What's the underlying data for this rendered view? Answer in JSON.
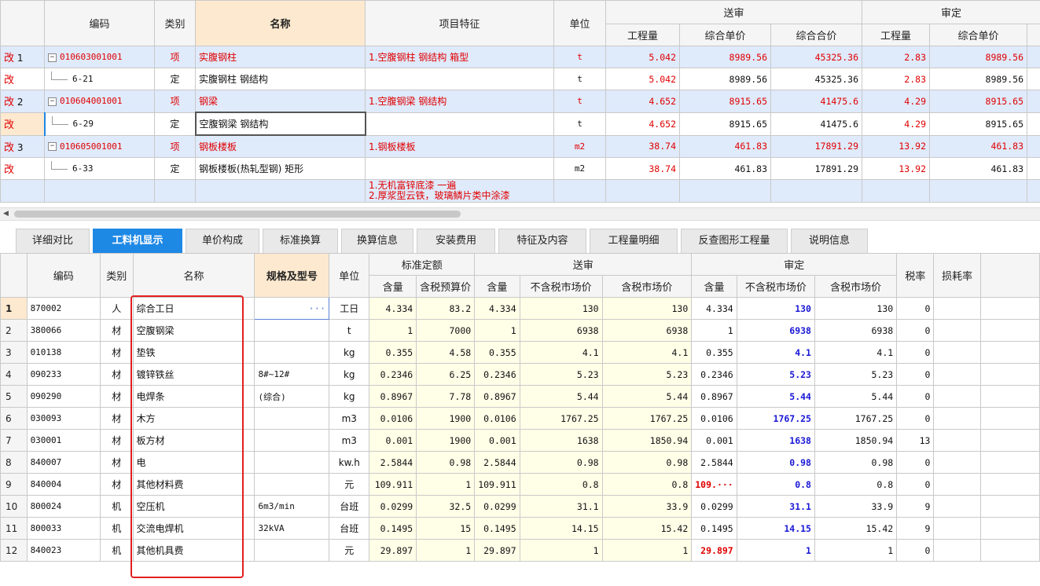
{
  "top_table": {
    "headers": {
      "code": "编码",
      "type": "类别",
      "name": "名称",
      "feature": "项目特征",
      "unit": "单位",
      "submit_group": "送审",
      "approve_group": "审定",
      "qty": "工程量",
      "unit_price": "综合单价",
      "total": "综合合价",
      "a_qty": "工程量",
      "a_unit_price": "综合单价"
    },
    "rows": [
      {
        "mark": "改",
        "idx": "1",
        "code": "010603001001",
        "type": "项",
        "name": "实腹钢柱",
        "feature": "1.空腹钢柱 钢结构 箱型",
        "unit": "t",
        "qty": "5.042",
        "price": "8989.56",
        "total": "45325.36",
        "a_qty": "2.83",
        "a_price": "8989.56"
      },
      {
        "mark": "改",
        "idx": "",
        "code": "6-21",
        "type": "定",
        "name": "实腹钢柱 钢结构",
        "feature": "",
        "unit": "t",
        "qty": "5.042",
        "price": "8989.56",
        "total": "45325.36",
        "a_qty": "2.83",
        "a_price": "8989.56"
      },
      {
        "mark": "改",
        "idx": "2",
        "code": "010604001001",
        "type": "项",
        "name": "钢梁",
        "feature": "1.空腹钢梁 钢结构",
        "unit": "t",
        "qty": "4.652",
        "price": "8915.65",
        "total": "41475.6",
        "a_qty": "4.29",
        "a_price": "8915.65"
      },
      {
        "mark": "改",
        "idx": "",
        "code": "6-29",
        "type": "定",
        "name": "空腹钢梁 钢结构",
        "feature": "",
        "unit": "t",
        "qty": "4.652",
        "price": "8915.65",
        "total": "41475.6",
        "a_qty": "4.29",
        "a_price": "8915.65"
      },
      {
        "mark": "改",
        "idx": "3",
        "code": "010605001001",
        "type": "项",
        "name": "钢板楼板",
        "feature": "1.钢板楼板",
        "unit": "m2",
        "qty": "38.74",
        "price": "461.83",
        "total": "17891.29",
        "a_qty": "13.92",
        "a_price": "461.83"
      },
      {
        "mark": "改",
        "idx": "",
        "code": "6-33",
        "type": "定",
        "name": "钢板楼板(热轧型钢) 矩形",
        "feature": "",
        "unit": "m2",
        "qty": "38.74",
        "price": "461.83",
        "total": "17891.29",
        "a_qty": "13.92",
        "a_price": "461.83"
      }
    ],
    "partial_feature_line1": "1.无机富锌底漆 一遍",
    "partial_feature_line2": "2.厚浆型云铁，玻璃鳞片类中涂漆"
  },
  "tabs": [
    "详细对比",
    "工料机显示",
    "单价构成",
    "标准换算",
    "换算信息",
    "安装费用",
    "特征及内容",
    "工程量明细",
    "反查图形工程量",
    "说明信息"
  ],
  "active_tab": "工料机显示",
  "bottom_table": {
    "headers": {
      "code": "编码",
      "type": "类别",
      "name": "名称",
      "spec": "规格及型号",
      "unit": "单位",
      "std_group": "标准定额",
      "submit_group": "送审",
      "approve_group": "审定",
      "tax": "税率",
      "loss": "损耗率",
      "std_qty": "含量",
      "std_price": "含税预算价",
      "s_qty": "含量",
      "s_excl": "不含税市场价",
      "s_incl": "含税市场价",
      "a_qty": "含量",
      "a_excl": "不含税市场价",
      "a_incl": "含税市场价"
    },
    "rows": [
      {
        "idx": "1",
        "code": "870002",
        "type": "人",
        "name": "综合工日",
        "spec": "",
        "unit": "工日",
        "std_qty": "4.334",
        "std_price": "83.2",
        "s_qty": "4.334",
        "s_excl": "130",
        "s_incl": "130",
        "a_qty": "4.334",
        "a_excl": "130",
        "a_incl": "130",
        "tax": "0"
      },
      {
        "idx": "2",
        "code": "380066",
        "type": "材",
        "name": "空腹钢梁",
        "spec": "",
        "unit": "t",
        "std_qty": "1",
        "std_price": "7000",
        "s_qty": "1",
        "s_excl": "6938",
        "s_incl": "6938",
        "a_qty": "1",
        "a_excl": "6938",
        "a_incl": "6938",
        "tax": "0"
      },
      {
        "idx": "3",
        "code": "010138",
        "type": "材",
        "name": "垫铁",
        "spec": "",
        "unit": "kg",
        "std_qty": "0.355",
        "std_price": "4.58",
        "s_qty": "0.355",
        "s_excl": "4.1",
        "s_incl": "4.1",
        "a_qty": "0.355",
        "a_excl": "4.1",
        "a_incl": "4.1",
        "tax": "0"
      },
      {
        "idx": "4",
        "code": "090233",
        "type": "材",
        "name": "镀锌铁丝",
        "spec": "8#~12#",
        "unit": "kg",
        "std_qty": "0.2346",
        "std_price": "6.25",
        "s_qty": "0.2346",
        "s_excl": "5.23",
        "s_incl": "5.23",
        "a_qty": "0.2346",
        "a_excl": "5.23",
        "a_incl": "5.23",
        "tax": "0"
      },
      {
        "idx": "5",
        "code": "090290",
        "type": "材",
        "name": "电焊条",
        "spec": "(综合)",
        "unit": "kg",
        "std_qty": "0.8967",
        "std_price": "7.78",
        "s_qty": "0.8967",
        "s_excl": "5.44",
        "s_incl": "5.44",
        "a_qty": "0.8967",
        "a_excl": "5.44",
        "a_incl": "5.44",
        "tax": "0"
      },
      {
        "idx": "6",
        "code": "030093",
        "type": "材",
        "name": "木方",
        "spec": "",
        "unit": "m3",
        "std_qty": "0.0106",
        "std_price": "1900",
        "s_qty": "0.0106",
        "s_excl": "1767.25",
        "s_incl": "1767.25",
        "a_qty": "0.0106",
        "a_excl": "1767.25",
        "a_incl": "1767.25",
        "tax": "0"
      },
      {
        "idx": "7",
        "code": "030001",
        "type": "材",
        "name": "板方材",
        "spec": "",
        "unit": "m3",
        "std_qty": "0.001",
        "std_price": "1900",
        "s_qty": "0.001",
        "s_excl": "1638",
        "s_incl": "1850.94",
        "a_qty": "0.001",
        "a_excl": "1638",
        "a_incl": "1850.94",
        "tax": "13"
      },
      {
        "idx": "8",
        "code": "840007",
        "type": "材",
        "name": "电",
        "spec": "",
        "unit": "kw.h",
        "std_qty": "2.5844",
        "std_price": "0.98",
        "s_qty": "2.5844",
        "s_excl": "0.98",
        "s_incl": "0.98",
        "a_qty": "2.5844",
        "a_excl": "0.98",
        "a_incl": "0.98",
        "tax": "0"
      },
      {
        "idx": "9",
        "code": "840004",
        "type": "材",
        "name": "其他材料费",
        "spec": "",
        "unit": "元",
        "std_qty": "109.911",
        "std_price": "1",
        "s_qty": "109.911",
        "s_excl": "0.8",
        "s_incl": "0.8",
        "a_qty": "109.···",
        "a_excl": "0.8",
        "a_incl": "0.8",
        "tax": "0"
      },
      {
        "idx": "10",
        "code": "800024",
        "type": "机",
        "name": "空压机",
        "spec": "6m3/min",
        "unit": "台班",
        "std_qty": "0.0299",
        "std_price": "32.5",
        "s_qty": "0.0299",
        "s_excl": "31.1",
        "s_incl": "33.9",
        "a_qty": "0.0299",
        "a_excl": "31.1",
        "a_incl": "33.9",
        "tax": "9"
      },
      {
        "idx": "11",
        "code": "800033",
        "type": "机",
        "name": "交流电焊机",
        "spec": "32kVA",
        "unit": "台班",
        "std_qty": "0.1495",
        "std_price": "15",
        "s_qty": "0.1495",
        "s_excl": "14.15",
        "s_incl": "15.42",
        "a_qty": "0.1495",
        "a_excl": "14.15",
        "a_incl": "15.42",
        "tax": "9"
      },
      {
        "idx": "12",
        "code": "840023",
        "type": "机",
        "name": "其他机具费",
        "spec": "",
        "unit": "元",
        "std_qty": "29.897",
        "std_price": "1",
        "s_qty": "29.897",
        "s_excl": "1",
        "s_incl": "1",
        "a_qty": "29.897",
        "a_excl": "1",
        "a_incl": "1",
        "tax": "0"
      }
    ]
  },
  "colors": {
    "accent": "#1e88e5",
    "red": "#e00000",
    "blue": "#1a18d6",
    "highlight_frame": "#e32020"
  }
}
